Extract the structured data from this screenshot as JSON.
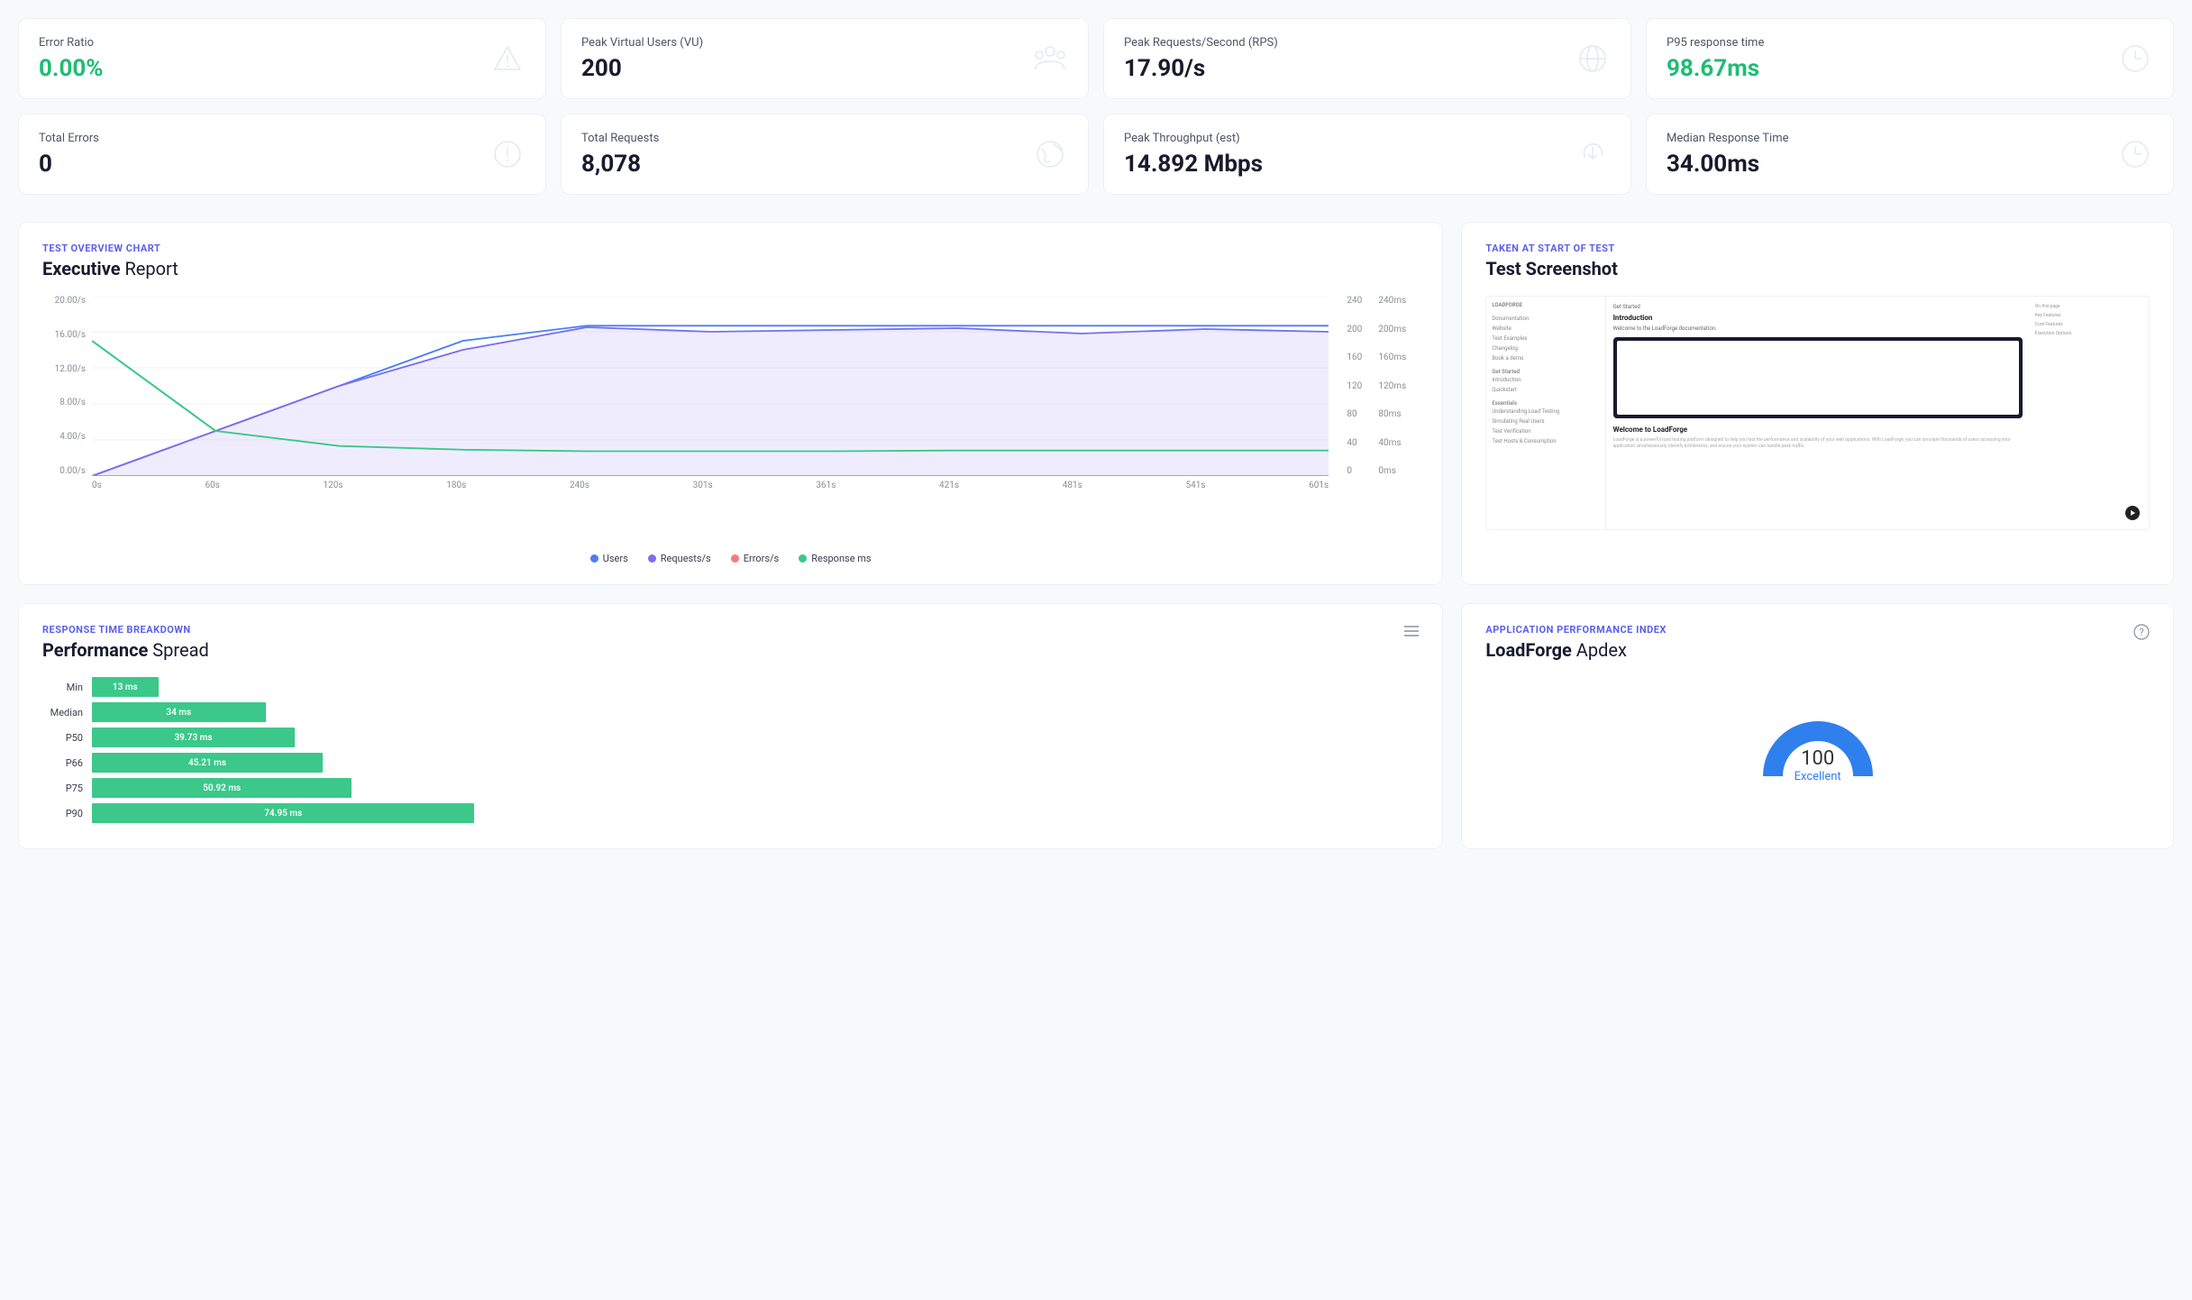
{
  "stats": [
    {
      "label": "Error Ratio",
      "value": "0.00%",
      "green": true,
      "icon": "alert"
    },
    {
      "label": "Peak Virtual Users (VU)",
      "value": "200",
      "green": false,
      "icon": "users"
    },
    {
      "label": "Peak Requests/Second (RPS)",
      "value": "17.90/s",
      "green": false,
      "icon": "globe"
    },
    {
      "label": "P95 response time",
      "value": "98.67ms",
      "green": true,
      "icon": "clock"
    },
    {
      "label": "Total Errors",
      "value": "0",
      "green": false,
      "icon": "circle-alert"
    },
    {
      "label": "Total Requests",
      "value": "8,078",
      "green": false,
      "icon": "earth"
    },
    {
      "label": "Peak Throughput (est)",
      "value": "14.892 Mbps",
      "green": false,
      "icon": "download"
    },
    {
      "label": "Median Response Time",
      "value": "34.00ms",
      "green": false,
      "icon": "clock"
    }
  ],
  "overview": {
    "eyebrow": "TEST OVERVIEW CHART",
    "title_bold": "Executive",
    "title_rest": " Report",
    "legend": [
      {
        "label": "Users",
        "color": "#4a7ff7"
      },
      {
        "label": "Requests/s",
        "color": "#7a6ff0"
      },
      {
        "label": "Errors/s",
        "color": "#f77a7a"
      },
      {
        "label": "Response ms",
        "color": "#3bc88a"
      }
    ]
  },
  "chart_data": {
    "type": "line",
    "x_categories": [
      "0s",
      "60s",
      "120s",
      "180s",
      "240s",
      "301s",
      "361s",
      "421s",
      "481s",
      "541s",
      "601s"
    ],
    "y_left_ticks": [
      "0.00/s",
      "4.00/s",
      "8.00/s",
      "12.00/s",
      "16.00/s",
      "20.00/s"
    ],
    "y_right1_ticks": [
      "0",
      "40",
      "80",
      "120",
      "160",
      "200",
      "240"
    ],
    "y_right2_ticks": [
      "0ms",
      "40ms",
      "80ms",
      "120ms",
      "160ms",
      "200ms",
      "240ms"
    ],
    "y_left_range": [
      0,
      20
    ],
    "y_right1_range": [
      0,
      240
    ],
    "y_right2_range": [
      0,
      240
    ],
    "series": [
      {
        "name": "Users",
        "axis": "right1",
        "color": "#4a7ff7",
        "values": [
          0,
          60,
          120,
          180,
          200,
          200,
          200,
          200,
          200,
          200,
          200
        ]
      },
      {
        "name": "Requests/s",
        "axis": "left",
        "color": "#7a6ff0",
        "values": [
          0,
          5,
          10,
          14,
          16.5,
          16,
          16.2,
          16.4,
          15.8,
          16.3,
          16
        ]
      },
      {
        "name": "Errors/s",
        "axis": "left",
        "color": "#f77a7a",
        "values": [
          0,
          0,
          0,
          0,
          0,
          0,
          0,
          0,
          0,
          0,
          0
        ]
      },
      {
        "name": "Response ms",
        "axis": "right2",
        "color": "#3bc88a",
        "values": [
          180,
          60,
          40,
          35,
          33,
          33,
          33,
          34,
          34,
          34,
          34
        ]
      }
    ]
  },
  "screenshot": {
    "eyebrow": "TAKEN AT START OF TEST",
    "title": "Test Screenshot",
    "thumb": {
      "brand": "LOADFORGE",
      "side_items": [
        "Documentation",
        "Website",
        "Test Examples",
        "Changelog",
        "Book a demo"
      ],
      "section1": "Get Started",
      "section1_items": [
        "Introduction",
        "Quickstart"
      ],
      "section2": "Essentials",
      "section2_items": [
        "Understanding Load Testing",
        "Simulating Real Users",
        "Test Verification",
        "Test Hosts & Consumption"
      ],
      "main_eyebrow": "Get Started",
      "main_title": "Introduction",
      "main_sub": "Welcome to the LoadForge documentation.",
      "welcome": "Welcome to LoadForge",
      "right_items": [
        "On this page",
        "Key Features",
        "Core Features",
        "Execution Options"
      ]
    }
  },
  "breakdown": {
    "eyebrow": "RESPONSE TIME BREAKDOWN",
    "title_bold": "Performance",
    "title_rest": " Spread",
    "bars": [
      {
        "label": "Min",
        "value_label": "13 ms",
        "value": 13
      },
      {
        "label": "Median",
        "value_label": "34 ms",
        "value": 34
      },
      {
        "label": "P50",
        "value_label": "39.73 ms",
        "value": 39.73
      },
      {
        "label": "P66",
        "value_label": "45.21 ms",
        "value": 45.21
      },
      {
        "label": "P75",
        "value_label": "50.92 ms",
        "value": 50.92
      },
      {
        "label": "P90",
        "value_label": "74.95 ms",
        "value": 74.95
      }
    ],
    "bar_max": 260
  },
  "apdex": {
    "eyebrow": "APPLICATION PERFORMANCE INDEX",
    "title_bold": "LoadForge",
    "title_rest": " Apdex",
    "value": "100",
    "label": "Excellent"
  }
}
